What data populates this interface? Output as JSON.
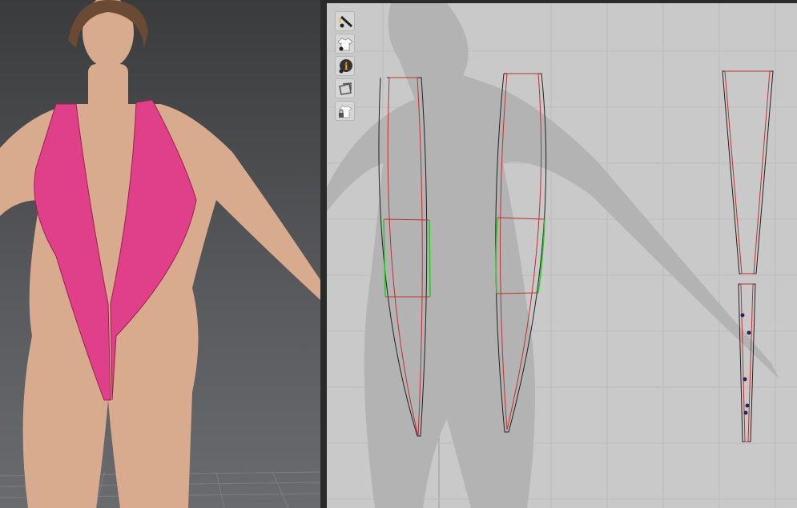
{
  "viewport3d": {
    "background_color": "#4a4b4e",
    "garment_color": "#e0408a"
  },
  "viewport2d": {
    "background_color": "#c9c9c9",
    "outline_color": "#222222",
    "seam_color": "#c03030",
    "selected_seam_color": "#22cc22",
    "pin_color": "#2a2060",
    "toolbar": [
      {
        "icon": "show-avatar-needle-icon"
      },
      {
        "icon": "show-garment-icon"
      },
      {
        "icon": "show-info-icon"
      },
      {
        "icon": "pattern-3d-icon"
      },
      {
        "icon": "lock-garment-icon"
      }
    ]
  }
}
